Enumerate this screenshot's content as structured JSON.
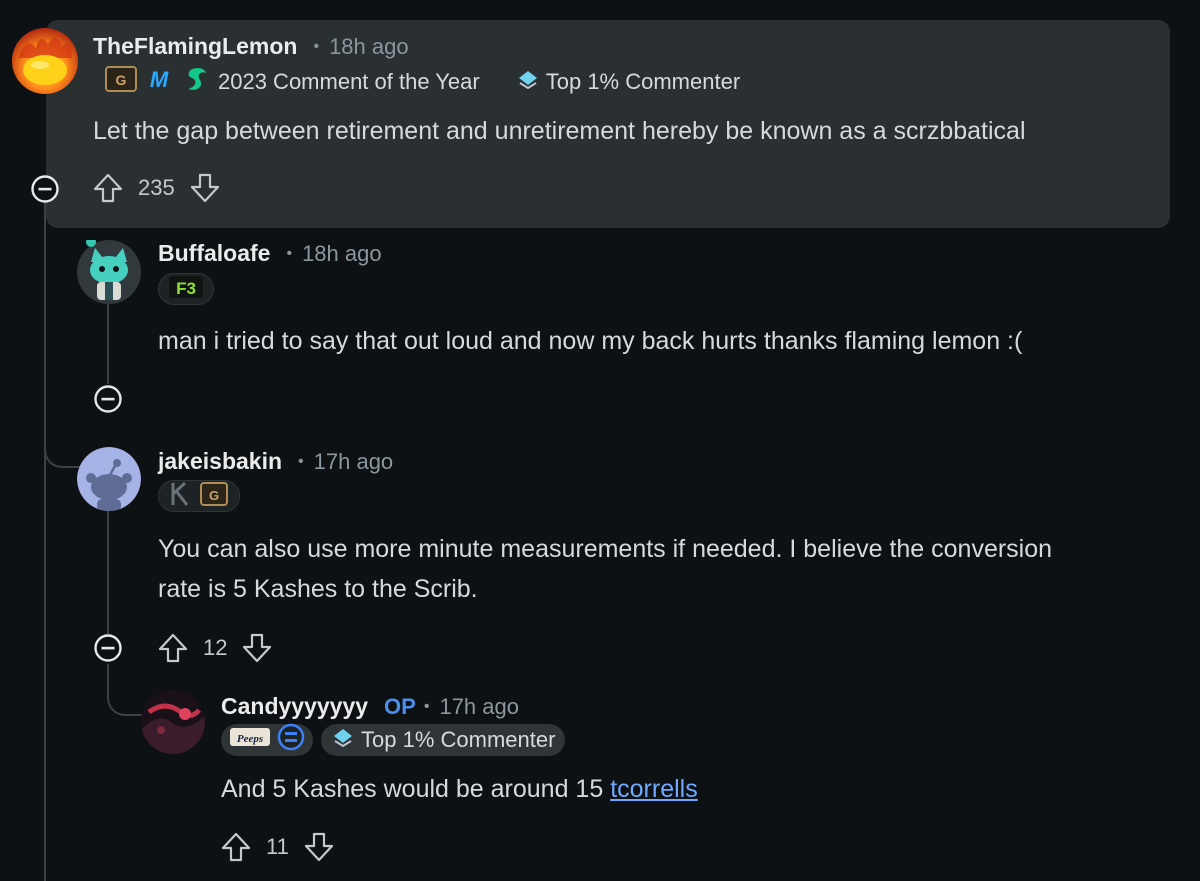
{
  "colors": {
    "background": "#0e1113",
    "highlight": "#2a2f32",
    "thread_line": "#3b4145",
    "op": "#4d8fe8",
    "link": "#6ea8ff"
  },
  "comments": [
    {
      "username": "TheFlamingLemon",
      "separator": "•",
      "time": "18h ago",
      "flair_text": "2023 Comment of the Year",
      "top_commenter": "Top 1% Commenter",
      "body": "Let the gap between retirement and unretirement hereby be known as a scrzbbatical",
      "votes": "235"
    },
    {
      "username": "Buffaloafe",
      "separator": "•",
      "time": "18h ago",
      "flair_badge": "F3",
      "body": "man i tried to say that out loud and now my back hurts thanks flaming lemon :("
    },
    {
      "username": "jakeisbakin",
      "separator": "•",
      "time": "17h ago",
      "body_line1": "You can also use more minute measurements if needed. I believe the conversion",
      "body_line2": "rate is 5 Kashes to the Scrib.",
      "votes": "12"
    },
    {
      "username": "Candyyyyyyy",
      "op_label": "OP",
      "separator": "•",
      "time": "17h ago",
      "flair_badge": "Peeps",
      "top_commenter": "Top 1% Commenter",
      "body_text": "And 5 Kashes would be around 15",
      "body_link": "tcorrells",
      "votes": "11"
    }
  ]
}
